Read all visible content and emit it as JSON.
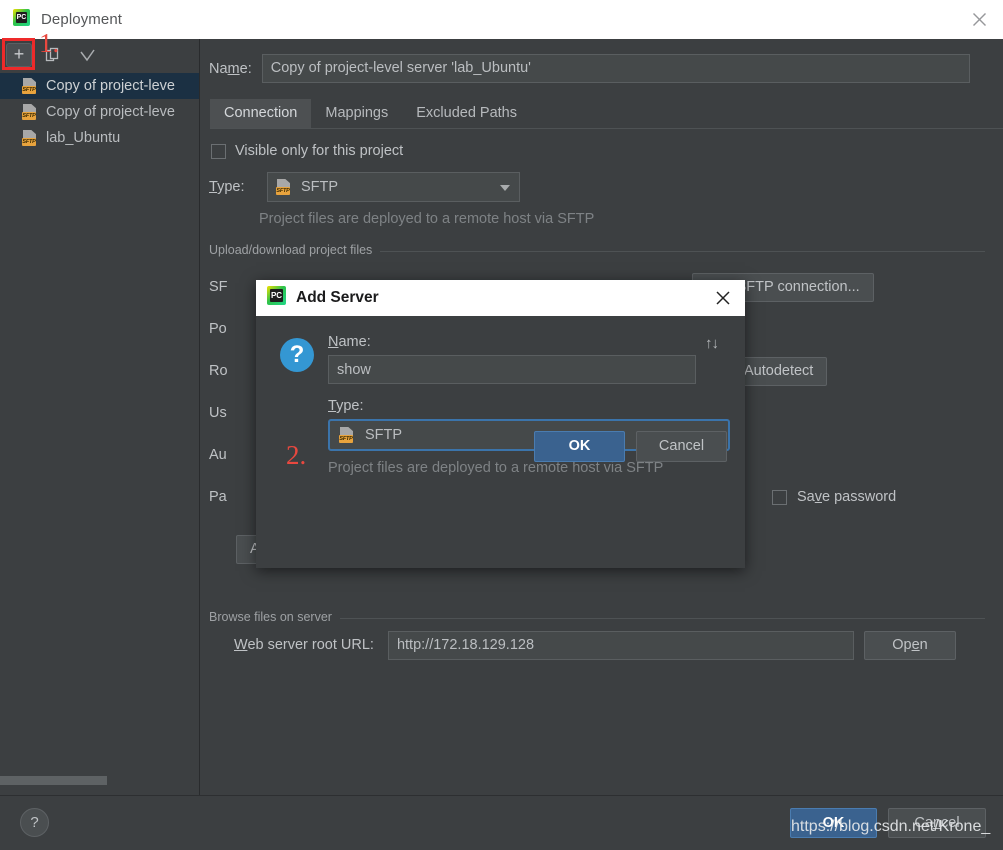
{
  "window": {
    "title": "Deployment",
    "app_icon": "pycharm-icon",
    "close_icon": "close-icon"
  },
  "sidebar": {
    "toolbar": [
      {
        "name": "add-server-button",
        "icon": "plus-icon",
        "label": "+"
      },
      {
        "name": "copy-server-button",
        "icon": "copy-icon",
        "label": ""
      },
      {
        "name": "set-default-button",
        "icon": "check-icon",
        "label": ""
      }
    ],
    "items": [
      {
        "label": "Copy of project-leve",
        "icon": "sftp-icon",
        "selected": true
      },
      {
        "label": "Copy of project-leve",
        "icon": "sftp-icon",
        "selected": false
      },
      {
        "label": "lab_Ubuntu",
        "icon": "sftp-icon",
        "selected": false
      }
    ]
  },
  "annotations": {
    "step1": "1.",
    "step2": "2."
  },
  "main": {
    "name_label": "Name:",
    "name_value": "Copy of project-level server 'lab_Ubuntu'",
    "tabs": [
      {
        "label": "Connection",
        "active": true
      },
      {
        "label": "Mappings",
        "active": false
      },
      {
        "label": "Excluded Paths",
        "active": false
      }
    ],
    "visible_only_label": "Visible only for this project",
    "type_label": "Type:",
    "type_value": "SFTP",
    "type_hint": "Project files are deployed to a remote host via SFTP",
    "upload_group": "Upload/download project files",
    "fields": [
      {
        "label": "SF",
        "full": "SFTP host:"
      },
      {
        "label": "Po",
        "full": "Port:"
      },
      {
        "label": "Ro",
        "full": "Root path:"
      },
      {
        "label": "Us",
        "full": "User name:"
      },
      {
        "label": "Au",
        "full": "Auth type:"
      },
      {
        "label": "Pa",
        "full": "Password:"
      }
    ],
    "test_connection_button": "Test SFTP connection...",
    "autodetect_button": "Autodetect",
    "save_password_label": "Save password",
    "advanced_options_button": "Advanced options...",
    "browse_group": "Browse files on server",
    "web_url_label": "Web server root URL:",
    "web_url_value": "http://172.18.129.128",
    "open_button": "Open"
  },
  "footer": {
    "help_label": "?",
    "ok_label": "OK",
    "cancel_label": "Cancel",
    "watermark": "https://blog.csdn.net/Krone_"
  },
  "modal": {
    "title": "Add Server",
    "app_icon": "pycharm-icon",
    "close_icon": "close-icon",
    "question_icon": "?",
    "name_label": "Name:",
    "name_value": "show",
    "swap_icon": "↑↓",
    "type_label": "Type:",
    "type_value": "SFTP",
    "type_hint": "Project files are deployed to a remote host via SFTP",
    "ok_label": "OK",
    "cancel_label": "Cancel"
  },
  "colors": {
    "background": "#3c3f41",
    "titlebar": "#ffffff",
    "accent_blue": "#3a628f",
    "focus_blue": "#3b74ab",
    "annotation_red": "#e8483f",
    "sftp_badge": "#e8a33d",
    "selection": "#1b3043"
  }
}
